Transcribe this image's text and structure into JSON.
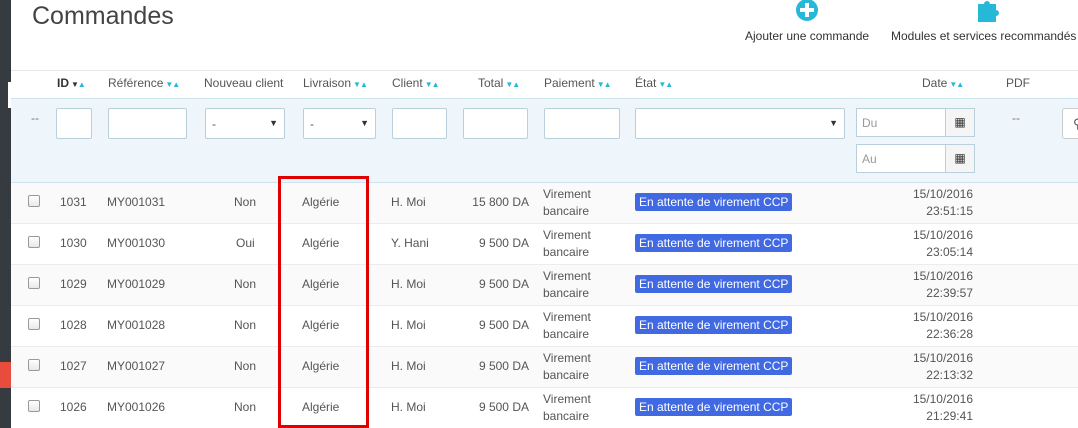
{
  "page": {
    "title": "Commandes"
  },
  "toolbar": {
    "add_order_label": "Ajouter une commande",
    "modules_label": "Modules et services recommandés",
    "accent": "#25b9d7"
  },
  "table": {
    "headers": {
      "id": "ID",
      "reference": "Référence",
      "new_client": "Nouveau client",
      "delivery": "Livraison",
      "client": "Client",
      "total": "Total",
      "payment": "Paiement",
      "status": "État",
      "date": "Date",
      "pdf": "PDF"
    },
    "filters": {
      "empty_marker": "--",
      "new_client_selected": "-",
      "delivery_selected": "-",
      "date_from_placeholder": "Du",
      "date_to_placeholder": "Au",
      "pdf_marker": "--"
    },
    "rows": [
      {
        "id": "1031",
        "reference": "MY001031",
        "new_client": "Non",
        "delivery": "Algérie",
        "client": "H. Moi",
        "total": "15 800 DA",
        "payment_line1": "Virement",
        "payment_line2": "bancaire",
        "status": "En attente de virement CCP",
        "date": "15/10/2016",
        "time": "23:51:15"
      },
      {
        "id": "1030",
        "reference": "MY001030",
        "new_client": "Oui",
        "delivery": "Algérie",
        "client": "Y. Hani",
        "total": "9 500 DA",
        "payment_line1": "Virement",
        "payment_line2": "bancaire",
        "status": "En attente de virement CCP",
        "date": "15/10/2016",
        "time": "23:05:14"
      },
      {
        "id": "1029",
        "reference": "MY001029",
        "new_client": "Non",
        "delivery": "Algérie",
        "client": "H. Moi",
        "total": "9 500 DA",
        "payment_line1": "Virement",
        "payment_line2": "bancaire",
        "status": "En attente de virement CCP",
        "date": "15/10/2016",
        "time": "22:39:57"
      },
      {
        "id": "1028",
        "reference": "MY001028",
        "new_client": "Non",
        "delivery": "Algérie",
        "client": "H. Moi",
        "total": "9 500 DA",
        "payment_line1": "Virement",
        "payment_line2": "bancaire",
        "status": "En attente de virement CCP",
        "date": "15/10/2016",
        "time": "22:36:28"
      },
      {
        "id": "1027",
        "reference": "MY001027",
        "new_client": "Non",
        "delivery": "Algérie",
        "client": "H. Moi",
        "total": "9 500 DA",
        "payment_line1": "Virement",
        "payment_line2": "bancaire",
        "status": "En attente de virement CCP",
        "date": "15/10/2016",
        "time": "22:13:32"
      },
      {
        "id": "1026",
        "reference": "MY001026",
        "new_client": "Non",
        "delivery": "Algérie",
        "client": "H. Moi",
        "total": "9 500 DA",
        "payment_line1": "Virement",
        "payment_line2": "bancaire",
        "status": "En attente de virement CCP",
        "date": "15/10/2016",
        "time": "21:29:41"
      }
    ],
    "status_color": "#4169e1",
    "highlight_color": "#e00000"
  }
}
